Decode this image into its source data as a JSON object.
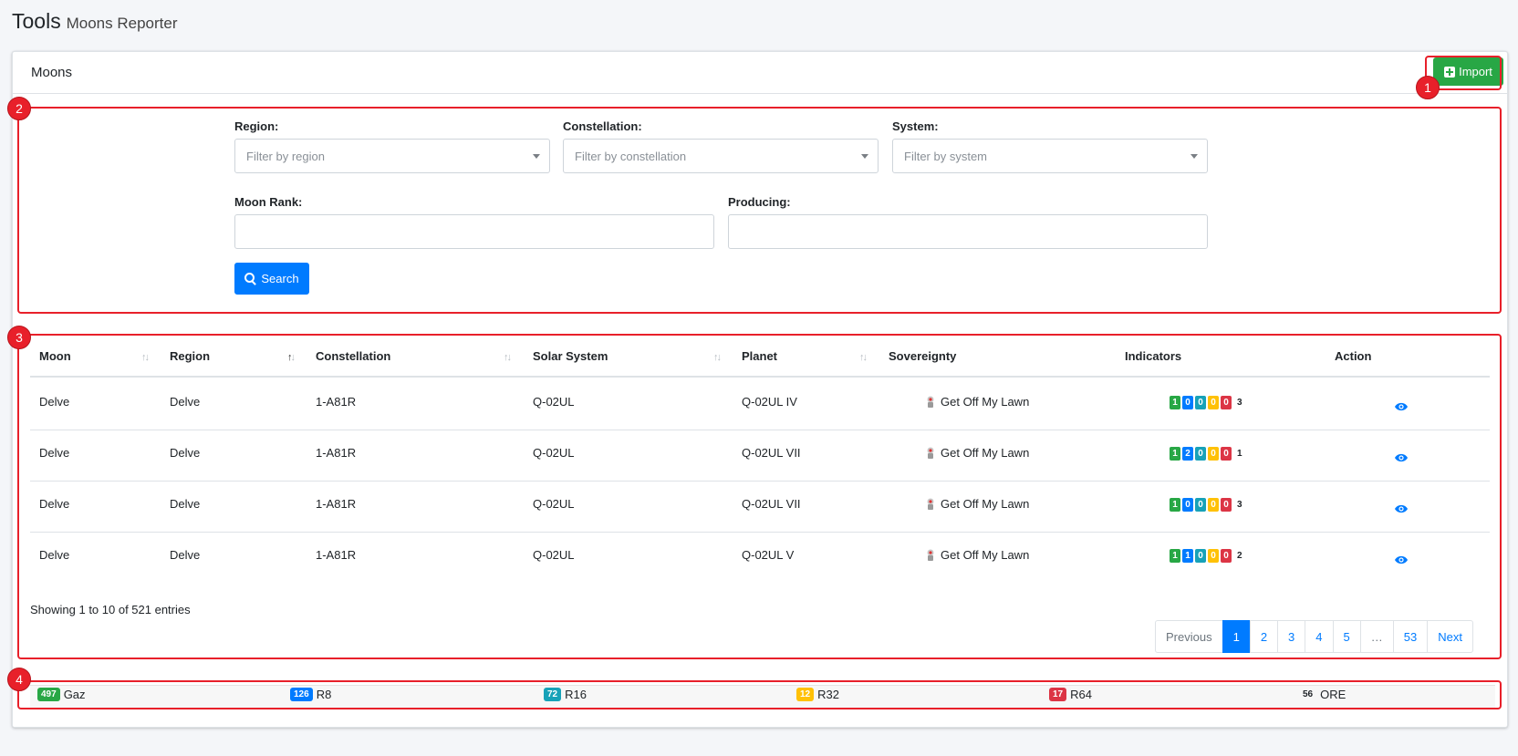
{
  "page": {
    "title": "Tools",
    "subtitle": "Moons Reporter"
  },
  "card": {
    "title": "Moons",
    "import_label": "Import"
  },
  "filters": {
    "region_label": "Region:",
    "region_placeholder": "Filter by region",
    "constellation_label": "Constellation:",
    "constellation_placeholder": "Filter by constellation",
    "system_label": "System:",
    "system_placeholder": "Filter by system",
    "rank_label": "Moon Rank:",
    "producing_label": "Producing:",
    "search_label": "Search"
  },
  "table": {
    "headers": [
      "Moon",
      "Region",
      "Constellation",
      "Solar System",
      "Planet",
      "Sovereignty",
      "Indicators",
      "Action"
    ],
    "rows": [
      {
        "moon": "Delve",
        "region": "Delve",
        "constellation": "1-A81R",
        "system": "Q-02UL",
        "planet": "Q-02UL IV",
        "sovereignty": "Get Off My Lawn",
        "indicators": [
          "1",
          "0",
          "0",
          "0",
          "0"
        ],
        "count": "3"
      },
      {
        "moon": "Delve",
        "region": "Delve",
        "constellation": "1-A81R",
        "system": "Q-02UL",
        "planet": "Q-02UL VII",
        "sovereignty": "Get Off My Lawn",
        "indicators": [
          "1",
          "2",
          "0",
          "0",
          "0"
        ],
        "count": "1"
      },
      {
        "moon": "Delve",
        "region": "Delve",
        "constellation": "1-A81R",
        "system": "Q-02UL",
        "planet": "Q-02UL VII",
        "sovereignty": "Get Off My Lawn",
        "indicators": [
          "1",
          "0",
          "0",
          "0",
          "0"
        ],
        "count": "3"
      },
      {
        "moon": "Delve",
        "region": "Delve",
        "constellation": "1-A81R",
        "system": "Q-02UL",
        "planet": "Q-02UL V",
        "sovereignty": "Get Off My Lawn",
        "indicators": [
          "1",
          "1",
          "0",
          "0",
          "0"
        ],
        "count": "2"
      }
    ],
    "info": "Showing 1 to 10 of 521 entries"
  },
  "pagination": {
    "previous": "Previous",
    "pages": [
      "1",
      "2",
      "3",
      "4",
      "5",
      "…",
      "53"
    ],
    "next": "Next",
    "current": "1"
  },
  "summary": [
    {
      "count": "497",
      "label": "Gaz",
      "color": "#28a745"
    },
    {
      "count": "126",
      "label": "R8",
      "color": "#007bff"
    },
    {
      "count": "72",
      "label": "R16",
      "color": "#17a2b8"
    },
    {
      "count": "12",
      "label": "R32",
      "color": "#ffc107"
    },
    {
      "count": "17",
      "label": "R64",
      "color": "#dc3545"
    },
    {
      "count": "56",
      "label": "ORE",
      "color": "#f7f7f7"
    }
  ],
  "annotations": [
    "1",
    "2",
    "3",
    "4"
  ],
  "indicator_colors": [
    "#28a745",
    "#007bff",
    "#17a2b8",
    "#ffc107",
    "#dc3545"
  ]
}
